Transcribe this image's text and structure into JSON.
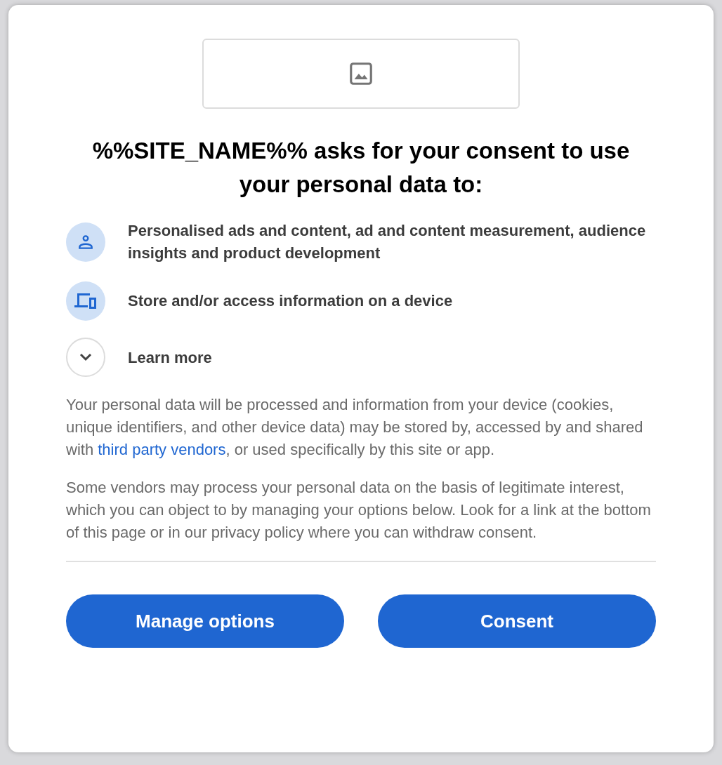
{
  "title": "%%SITE_NAME%% asks for your consent to use your personal data to:",
  "purposes": [
    {
      "kind": "person",
      "text": "Personalised ads and content, ad and content measurement, audience insights and product development"
    },
    {
      "kind": "device",
      "text": "Store and/or access information on a device"
    }
  ],
  "learn_more": {
    "label": "Learn more",
    "expanded": false
  },
  "paragraphs": [
    {
      "before": "Your personal data will be processed and information from your device (cookies, unique identifiers, and other device data) may be stored by, accessed by and shared with ",
      "link": "third party vendors",
      "after": ", or used specifically by this site or app."
    },
    {
      "before": "Some vendors may process your personal data on the basis of legitimate interest, which you can object to by managing your options below. Look for a link at the bottom of this page or in our privacy policy where you can withdraw consent."
    }
  ],
  "buttons": [
    "Manage options",
    "Consent"
  ]
}
